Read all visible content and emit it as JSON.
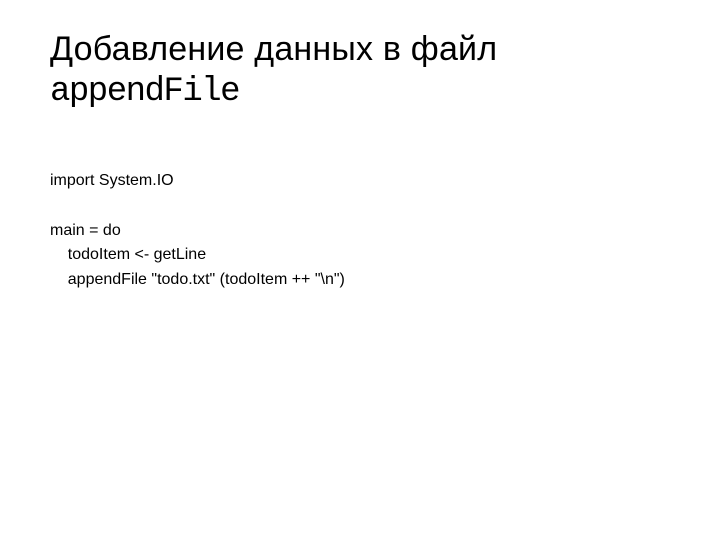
{
  "title": {
    "line1": "Добавление данных в файл",
    "line2": "appendFile"
  },
  "code": {
    "line1": "import System.IO",
    "blank1": "",
    "line2": "main = do",
    "line3": "    todoItem <- getLine",
    "line4": "    appendFile \"todo.txt\" (todoItem ++ \"\\n\")"
  }
}
